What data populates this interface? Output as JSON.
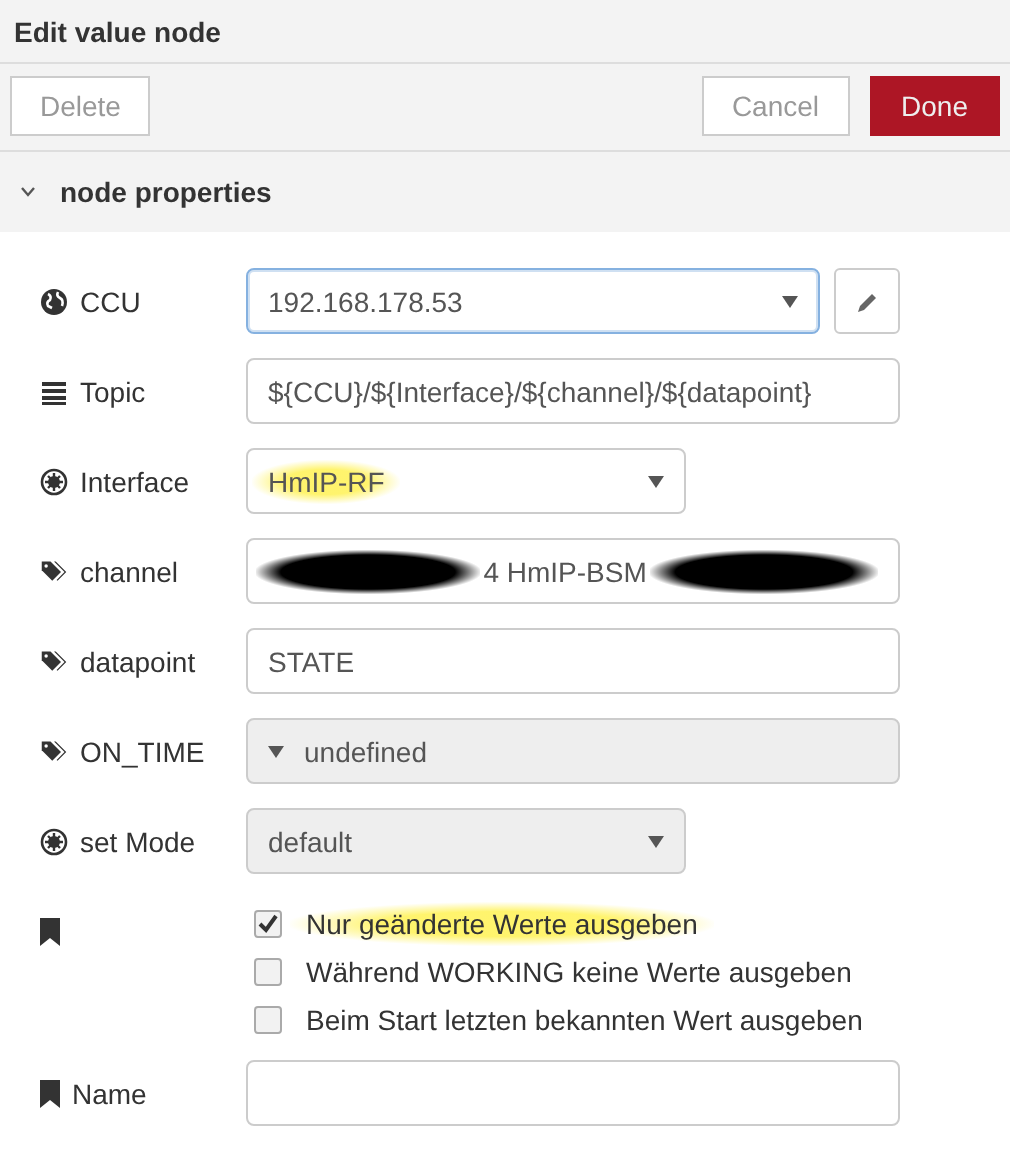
{
  "window": {
    "title": "Edit value node"
  },
  "buttons": [
    {
      "label": "Delete",
      "kind": "secondary"
    },
    {
      "label": "Cancel",
      "kind": "secondary"
    },
    {
      "label": "Done",
      "kind": "primary"
    }
  ],
  "section": {
    "title": "node properties",
    "expanded": true
  },
  "rows": [
    {
      "label": "CCU",
      "kind": "select-edit",
      "value": "192.168.178.53",
      "focused": true
    },
    {
      "label": "Topic",
      "kind": "input",
      "value": "${CCU}/${Interface}/${channel}/${datapoint}"
    },
    {
      "label": "Interface",
      "kind": "select",
      "value": "HmIP-RF",
      "highlighted": true,
      "disabled": false
    },
    {
      "label": "channel",
      "kind": "input",
      "value": "4 HmIP-BSM",
      "redacted": true
    },
    {
      "label": "datapoint",
      "kind": "input",
      "value": "STATE"
    },
    {
      "label": "ON_TIME",
      "kind": "typed",
      "value": "undefined"
    },
    {
      "label": "set Mode",
      "kind": "select",
      "value": "default",
      "disabled": true
    },
    {
      "kind": "checkboxes",
      "options": [
        {
          "label": "Nur geänderte Werte ausgeben",
          "checked": true,
          "highlighted": true
        },
        {
          "label": "Während WORKING keine Werte ausgeben",
          "checked": false,
          "highlighted": false
        },
        {
          "label": "Beim Start letzten bekannten Wert ausgeben",
          "checked": false,
          "highlighted": false
        }
      ]
    },
    {
      "label": "Name",
      "kind": "input"
    }
  ]
}
